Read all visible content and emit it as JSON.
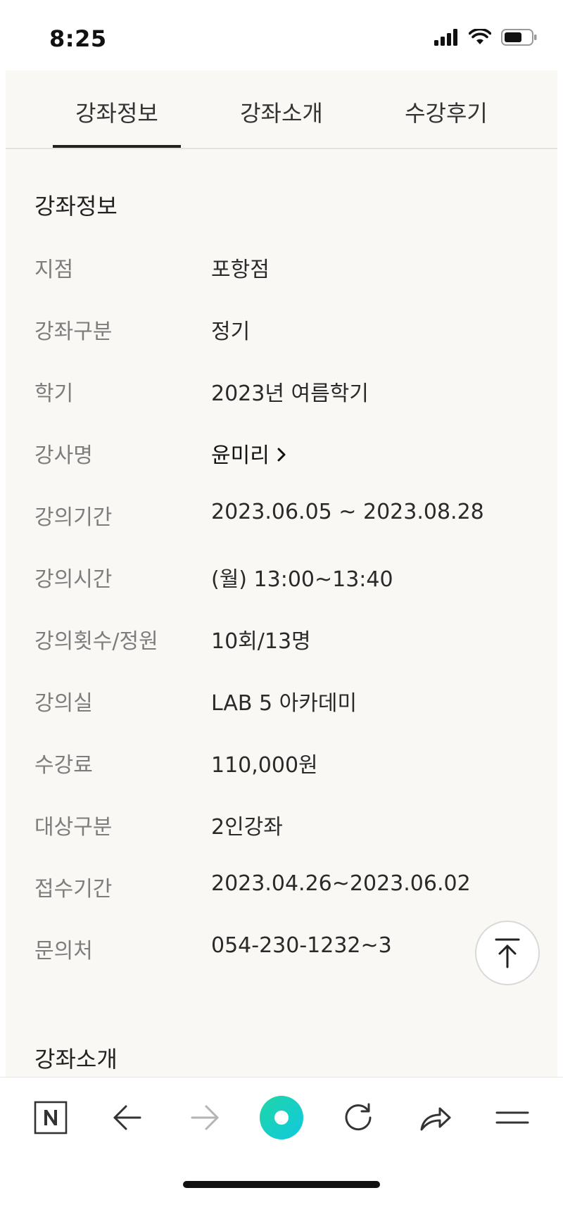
{
  "status_bar": {
    "time": "8:25"
  },
  "tabs": [
    {
      "label": "강좌정보",
      "active": true
    },
    {
      "label": "강좌소개",
      "active": false
    },
    {
      "label": "수강후기",
      "active": false
    }
  ],
  "section": {
    "title": "강좌정보",
    "rows": [
      {
        "label": "지점",
        "value": "포항점"
      },
      {
        "label": "강좌구분",
        "value": "정기"
      },
      {
        "label": "학기",
        "value": "2023년 여름학기"
      },
      {
        "label": "강사명",
        "value": "윤미리"
      },
      {
        "label": "강의기간",
        "value": "2023.06.05 ~ 2023.08.28"
      },
      {
        "label": "강의시간",
        "value": "(월) 13:00~13:40"
      },
      {
        "label": "강의횟수/정원",
        "value": "10회/13명"
      },
      {
        "label": "강의실",
        "value": "LAB 5 아카데미"
      },
      {
        "label": "수강료",
        "value": "110,000원"
      },
      {
        "label": "대상구분",
        "value": "2인강좌"
      },
      {
        "label": "접수기간",
        "value": "2023.04.26~2023.06.02"
      },
      {
        "label": "문의처",
        "value": "054-230-1232~3"
      }
    ]
  },
  "next_section": {
    "title": "강좌소개"
  },
  "colors": {
    "accent_green": "#1ed7a5",
    "accent_cyan": "#12c8e0",
    "panel_bg": "#f9f8f5"
  }
}
